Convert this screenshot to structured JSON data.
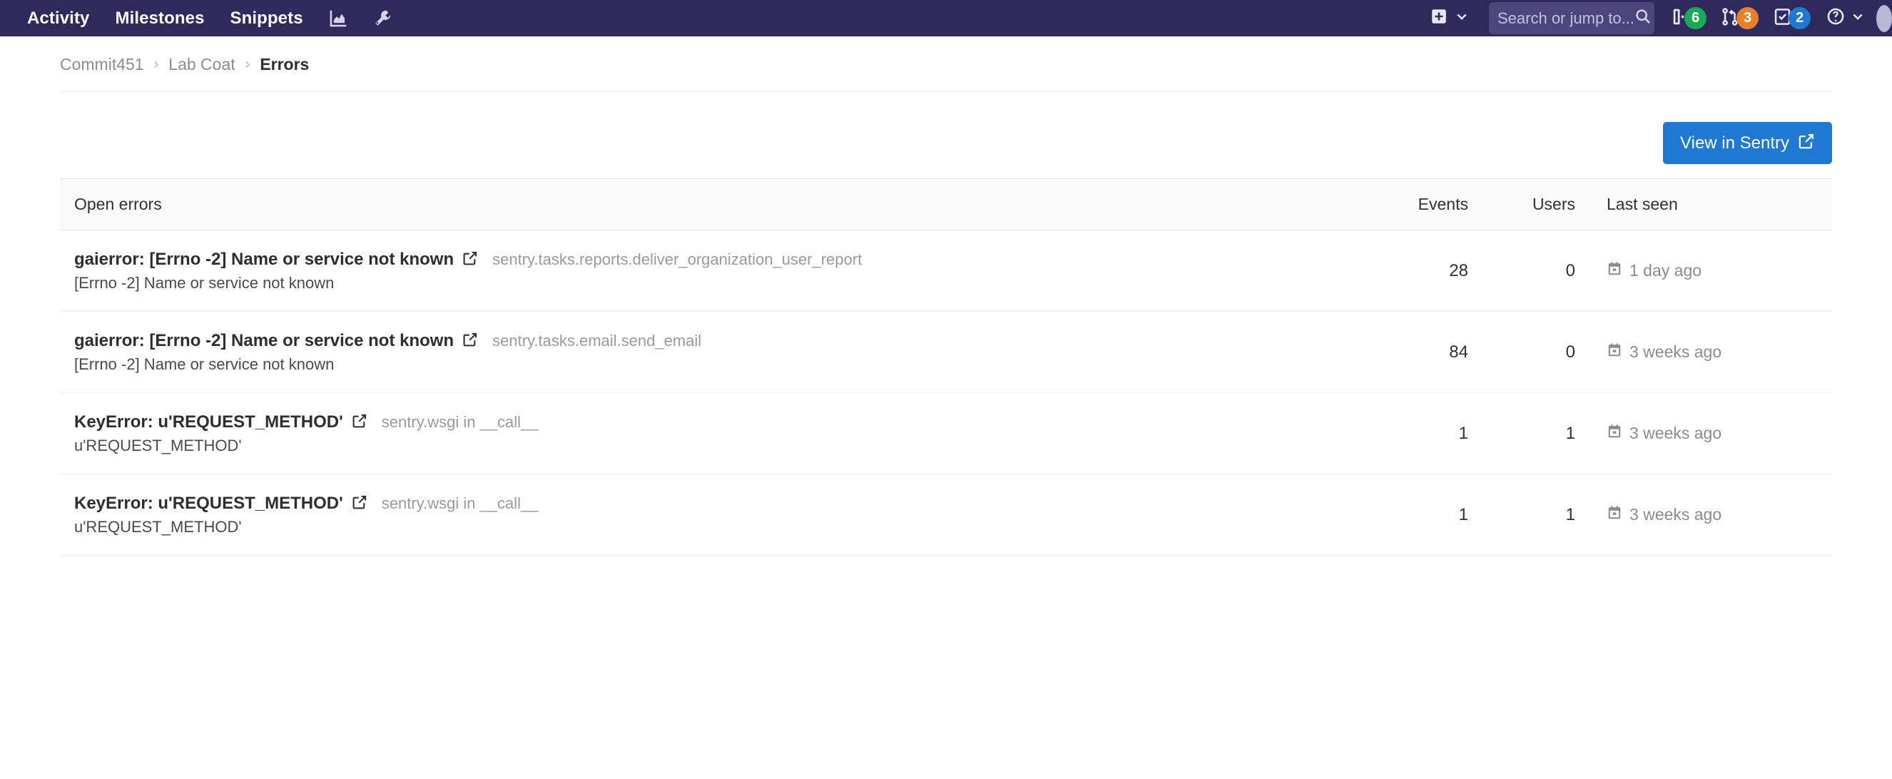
{
  "navbar": {
    "links": [
      {
        "label": "Activity",
        "name": "nav-activity"
      },
      {
        "label": "Milestones",
        "name": "nav-milestones"
      },
      {
        "label": "Snippets",
        "name": "nav-snippets"
      }
    ],
    "icon_links": [
      {
        "icon": "chart-icon",
        "name": "nav-analytics"
      },
      {
        "icon": "wrench-icon",
        "name": "nav-admin"
      }
    ],
    "create": {
      "icon": "plus-square-icon",
      "chevron": "chevron-down-icon"
    },
    "search": {
      "placeholder": "Search or jump to...",
      "value": "",
      "icon": "search-icon"
    },
    "counters": [
      {
        "name": "issues-counter",
        "icon": "issues-icon",
        "count": "6",
        "color": "#1aaa55"
      },
      {
        "name": "merge-requests-counter",
        "icon": "merge-request-icon",
        "count": "3",
        "color": "#e8802a"
      },
      {
        "name": "todos-counter",
        "icon": "todo-check-icon",
        "count": "2",
        "color": "#1f78d1"
      }
    ],
    "help": {
      "icon": "question-circle-icon",
      "chevron": "chevron-down-icon"
    },
    "colors": {
      "background": "#2e2a5b",
      "search_background": "#4b477c",
      "text": "#ffffff"
    }
  },
  "breadcrumb": {
    "items": [
      {
        "label": "Commit451",
        "current": false
      },
      {
        "label": "Lab Coat",
        "current": false
      },
      {
        "label": "Errors",
        "current": true
      }
    ],
    "separator": "›"
  },
  "actions": {
    "view_in_sentry": {
      "label": "View in Sentry",
      "icon": "external-link-icon",
      "color": "#1f78d1"
    }
  },
  "table": {
    "headers": {
      "title": "Open errors",
      "events": "Events",
      "users": "Users",
      "last_seen": "Last seen"
    },
    "rows": [
      {
        "title": "gaierror: [Errno -2] Name or service not known",
        "external_icon": "external-link-icon",
        "culprit": "sentry.tasks.reports.deliver_organization_user_report",
        "subtitle": "[Errno -2] Name or service not known",
        "events": "28",
        "users": "0",
        "last_seen": "1 day ago",
        "last_seen_icon": "calendar-icon"
      },
      {
        "title": "gaierror: [Errno -2] Name or service not known",
        "external_icon": "external-link-icon",
        "culprit": "sentry.tasks.email.send_email",
        "subtitle": "[Errno -2] Name or service not known",
        "events": "84",
        "users": "0",
        "last_seen": "3 weeks ago",
        "last_seen_icon": "calendar-icon"
      },
      {
        "title": "KeyError: u'REQUEST_METHOD'",
        "external_icon": "external-link-icon",
        "culprit": "sentry.wsgi in __call__",
        "subtitle": "u'REQUEST_METHOD'",
        "events": "1",
        "users": "1",
        "last_seen": "3 weeks ago",
        "last_seen_icon": "calendar-icon"
      },
      {
        "title": "KeyError: u'REQUEST_METHOD'",
        "external_icon": "external-link-icon",
        "culprit": "sentry.wsgi in __call__",
        "subtitle": "u'REQUEST_METHOD'",
        "events": "1",
        "users": "1",
        "last_seen": "3 weeks ago",
        "last_seen_icon": "calendar-icon"
      }
    ]
  }
}
